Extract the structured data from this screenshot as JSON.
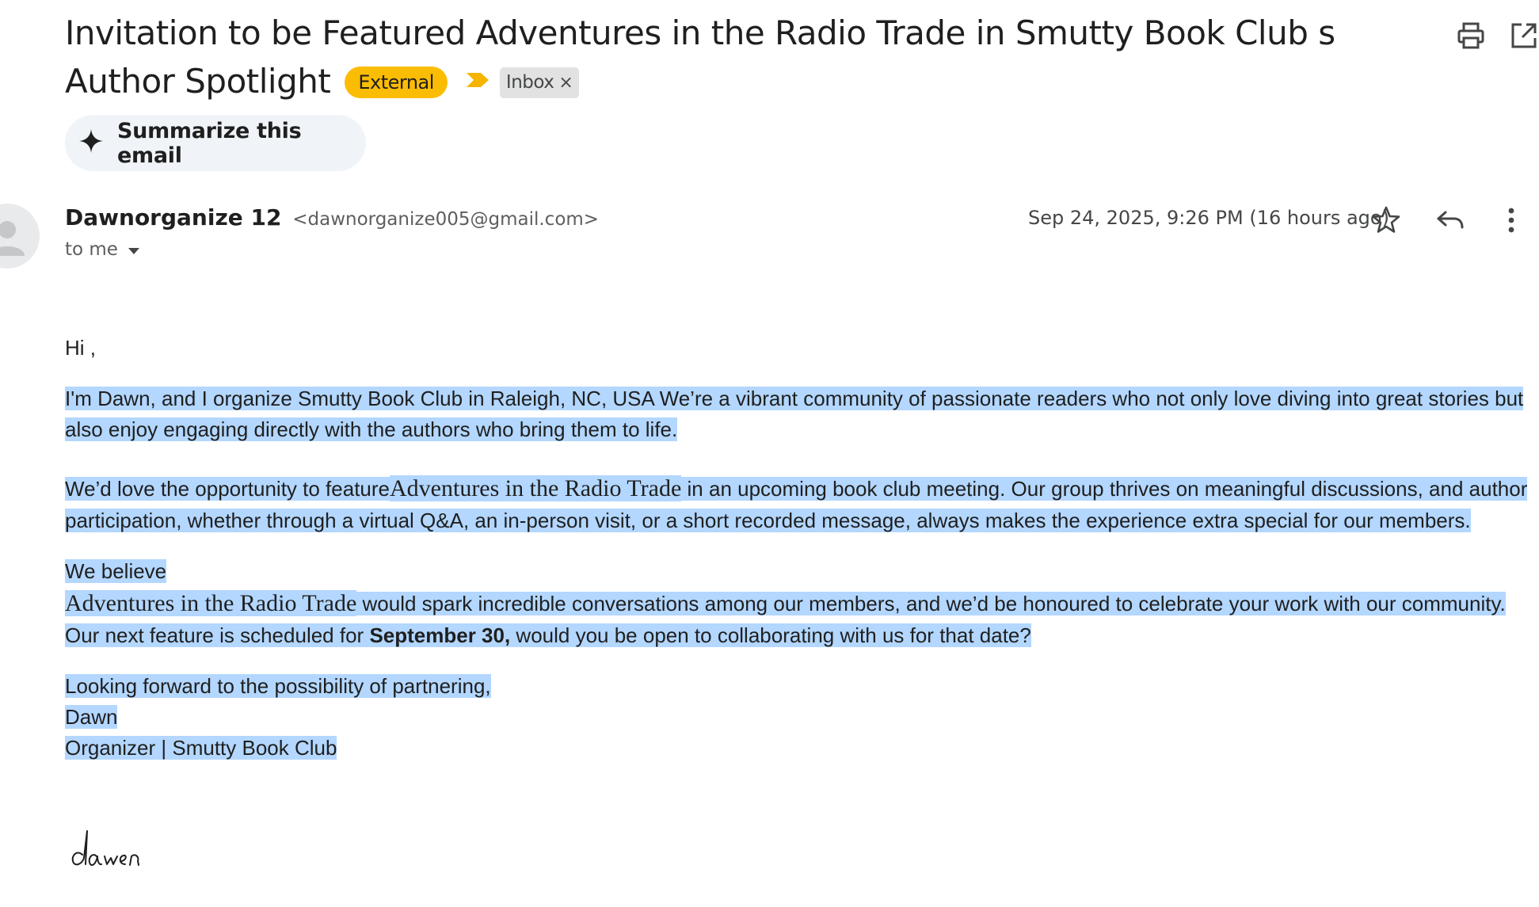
{
  "email": {
    "subject": "Invitation to be Featured Adventures in the Radio Trade in Smutty Book Club s Author Spotlight",
    "labels": {
      "external": "External",
      "inbox": "Inbox",
      "remove_icon": "×"
    },
    "toolbar_icons": [
      "printer-icon",
      "open-in-new-window-icon"
    ],
    "summarize_label": "Summarize this email",
    "sender": {
      "name": "Dawnorganize 12",
      "email": "<dawnorganize005@gmail.com>",
      "recipient": "to me"
    },
    "date": "Sep 24, 2025, 9:26 PM (16 hours ago)",
    "header_icons": [
      "star-icon",
      "reply-icon",
      "more-vert-icon"
    ],
    "body": {
      "greeting": "Hi ,",
      "p1": "I'm Dawn, and I organize Smutty Book Club in  Raleigh, NC, USA   We’re a vibrant community of passionate readers who not only love diving into great stories but also enjoy engaging directly with the authors who bring them to life.",
      "p2_pre": "We’d love the opportunity to feature",
      "book_title": "Adventures in the Radio Trade",
      "p2_post": " in an upcoming book club meeting. Our group thrives on meaningful discussions, and author participation, whether through a virtual Q&A, an in-person visit, or a short recorded message, always makes the experience extra special for our members.",
      "p3_a": "We believe",
      "p3_b": " would spark incredible conversations among our members, and we’d be honoured to celebrate your work with our community.",
      "p3_c": "Our next feature is scheduled for ",
      "p3_date": "September 30,",
      "p3_d": " would you be open to collaborating with us for that date?",
      "closing": "Looking forward to the possibility of partnering,",
      "sign_name": "Dawn",
      "sign_title": "Organizer | Smutty Book Club",
      "signature_script": "dawn"
    }
  },
  "colors": {
    "external_chip": "#fbbc04",
    "importance_marker": "#f4b400",
    "inbox_chip": "#e2e2e2",
    "summarize_bg": "#f0f4f9",
    "selection_highlight": "#b3d7ff"
  }
}
